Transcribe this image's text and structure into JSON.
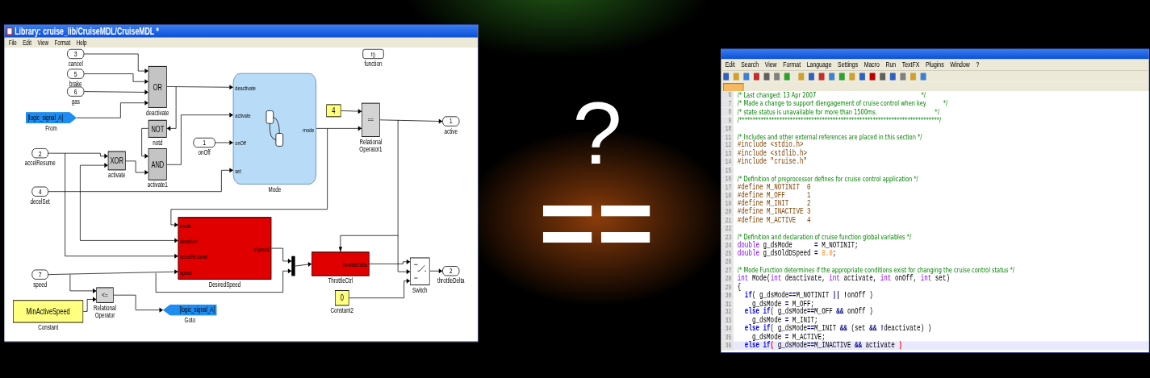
{
  "left_window": {
    "title": "Library: cruise_lib/CruiseMDL/CruiseMDL *",
    "menu": [
      "File",
      "Edit",
      "View",
      "Format",
      "Help"
    ],
    "blocks": [
      {
        "kind": "inport",
        "text": "3",
        "caption": "cancel"
      },
      {
        "kind": "gate",
        "text": "OR",
        "caption": "deactivate"
      },
      {
        "kind": "chart",
        "caption": "Mode",
        "inputs": [
          "deactivate",
          "activate",
          "onOff",
          "set"
        ],
        "outputs": [
          "mode"
        ]
      },
      {
        "kind": "function",
        "text": "f()",
        "caption": "function"
      },
      {
        "kind": "inport",
        "text": "5",
        "caption": "brake"
      },
      {
        "kind": "inport",
        "text": "6",
        "caption": "gas"
      },
      {
        "kind": "from",
        "text": "[logic_signal_A]",
        "caption": "From"
      },
      {
        "kind": "constant",
        "text": "4"
      },
      {
        "kind": "relop",
        "text": "==",
        "caption": "Relational Operator1"
      },
      {
        "kind": "outport",
        "text": "1",
        "caption": "active"
      },
      {
        "kind": "gate",
        "text": "NOT",
        "caption": "notd"
      },
      {
        "kind": "inport",
        "text": "1",
        "caption": "onOff"
      },
      {
        "kind": "inport",
        "text": "2",
        "caption": "accelResume"
      },
      {
        "kind": "gate",
        "text": "XOR",
        "caption": "activate"
      },
      {
        "kind": "gate",
        "text": "AND",
        "caption": "activate1"
      },
      {
        "kind": "inport",
        "text": "4",
        "caption": "decelSet"
      },
      {
        "kind": "inport",
        "text": "7",
        "caption": "speed"
      },
      {
        "kind": "subsystem",
        "caption": "DesiredSpeed",
        "inputs": [
          "mode",
          "decelSet",
          "accelResume",
          "speed"
        ],
        "outputs": [
          "dSpeed"
        ]
      },
      {
        "kind": "mux"
      },
      {
        "kind": "subsystem",
        "caption": "ThrottleCtrl",
        "outputs": [
          "throttleDelta"
        ]
      },
      {
        "kind": "switch",
        "caption": "Switch"
      },
      {
        "kind": "outport",
        "text": "2",
        "caption": "throttleDelta"
      },
      {
        "kind": "relop",
        "text": "<=",
        "caption": "Relational Operator"
      },
      {
        "kind": "constant",
        "text": "MinActiveSpeed",
        "caption": "Constant"
      },
      {
        "kind": "goto",
        "text": "[logic_signal_A]",
        "caption": "Goto"
      },
      {
        "kind": "constant",
        "text": "0",
        "caption": "Constant2"
      }
    ]
  },
  "center": {
    "question_mark": "?",
    "equals_sign": "=="
  },
  "right_window": {
    "menu": [
      "Edit",
      "Search",
      "View",
      "Format",
      "Language",
      "Settings",
      "Macro",
      "Run",
      "TextFX",
      "Plugins",
      "Window",
      "?"
    ],
    "code_lines": [
      {
        "number": "6",
        "current": false,
        "tokens": [
          {
            "kind": "comment",
            "text": "/* Last changed: 13 Apr 2007                                                              */"
          }
        ]
      },
      {
        "number": "7",
        "current": false,
        "tokens": [
          {
            "kind": "comment",
            "text": "/* Made a change to support diengagement of cruise control when key          */"
          }
        ]
      },
      {
        "number": "8",
        "current": false,
        "tokens": [
          {
            "kind": "comment",
            "text": "/* state status is unavailable for more than 1500ms.                                  */"
          }
        ]
      },
      {
        "number": "9",
        "current": false,
        "tokens": [
          {
            "kind": "comment",
            "text": "/***************************************************************************/"
          }
        ]
      },
      {
        "number": "10",
        "current": false
      },
      {
        "number": "11",
        "current": false,
        "tokens": [
          {
            "kind": "comment",
            "text": "/* Includes and other external references are placed in this section */"
          }
        ]
      },
      {
        "number": "12",
        "current": false,
        "tokens": [
          {
            "kind": "directive",
            "text": "#include <stdio.h>"
          }
        ]
      },
      {
        "number": "13",
        "current": false,
        "tokens": [
          {
            "kind": "directive",
            "text": "#include <stdlib.h>"
          }
        ]
      },
      {
        "number": "14",
        "current": false,
        "tokens": [
          {
            "kind": "directive",
            "text": "#include \"cruise.h\""
          }
        ]
      },
      {
        "number": "15",
        "current": false
      },
      {
        "number": "16",
        "current": false,
        "tokens": [
          {
            "kind": "comment",
            "text": "/* Definition of preprocessor defines for cruise control application */"
          }
        ]
      },
      {
        "number": "17",
        "current": false,
        "tokens": [
          {
            "kind": "directive",
            "text": "#define M_NOTINIT  0"
          }
        ]
      },
      {
        "number": "18",
        "current": false,
        "tokens": [
          {
            "kind": "directive",
            "text": "#define M_OFF      1"
          }
        ]
      },
      {
        "number": "19",
        "current": false,
        "tokens": [
          {
            "kind": "directive",
            "text": "#define M_INIT     2"
          }
        ]
      },
      {
        "number": "20",
        "current": false,
        "tokens": [
          {
            "kind": "directive",
            "text": "#define M_INACTIVE 3"
          }
        ]
      },
      {
        "number": "21",
        "current": false,
        "tokens": [
          {
            "kind": "directive",
            "text": "#define M_ACTIVE   4"
          }
        ]
      },
      {
        "number": "22",
        "current": false
      },
      {
        "number": "23",
        "current": false,
        "tokens": [
          {
            "kind": "comment",
            "text": "/* Definition and declaration of cruise function global variables */"
          }
        ]
      },
      {
        "number": "24",
        "current": false,
        "tokens": [
          {
            "kind": "type",
            "text": "double"
          },
          {
            "kind": "plain",
            "text": " g_dsMode      "
          },
          {
            "kind": "operator",
            "text": "="
          },
          {
            "kind": "plain",
            "text": " M_NOTINIT;"
          }
        ]
      },
      {
        "number": "25",
        "current": false,
        "tokens": [
          {
            "kind": "type",
            "text": "double"
          },
          {
            "kind": "plain",
            "text": " g_dsOldDSpeed "
          },
          {
            "kind": "operator",
            "text": "="
          },
          {
            "kind": "number",
            "text": " 0.0"
          },
          {
            "kind": "plain",
            "text": ";"
          }
        ]
      },
      {
        "number": "26",
        "current": false
      },
      {
        "number": "27",
        "current": false,
        "tokens": [
          {
            "kind": "comment",
            "text": "/* Mode Function determines if the appropriate conditions exist for changing the cruise control status */"
          }
        ]
      },
      {
        "number": "28",
        "current": false,
        "tokens": [
          {
            "kind": "type",
            "text": "int"
          },
          {
            "kind": "plain",
            "text": " Mode("
          },
          {
            "kind": "type",
            "text": "int"
          },
          {
            "kind": "plain",
            "text": " deactivate, "
          },
          {
            "kind": "type",
            "text": "int"
          },
          {
            "kind": "plain",
            "text": " activate, "
          },
          {
            "kind": "type",
            "text": "int"
          },
          {
            "kind": "plain",
            "text": " onOff, "
          },
          {
            "kind": "type",
            "text": "int"
          },
          {
            "kind": "plain",
            "text": " set)"
          }
        ]
      },
      {
        "number": "29",
        "current": false,
        "tokens": [
          {
            "kind": "plain",
            "text": "{"
          }
        ]
      },
      {
        "number": "30",
        "current": false,
        "tokens": [
          {
            "kind": "keyword",
            "text": "  if"
          },
          {
            "kind": "plain",
            "text": "( g_dsMode"
          },
          {
            "kind": "operator",
            "text": "=="
          },
          {
            "kind": "plain",
            "text": "M_NOTINIT "
          },
          {
            "kind": "operator",
            "text": "|| !"
          },
          {
            "kind": "plain",
            "text": "onOff )"
          }
        ]
      },
      {
        "number": "31",
        "current": false,
        "tokens": [
          {
            "kind": "plain",
            "text": "    g_dsMode "
          },
          {
            "kind": "operator",
            "text": "="
          },
          {
            "kind": "plain",
            "text": " M_OFF;"
          }
        ]
      },
      {
        "number": "32",
        "current": false,
        "tokens": [
          {
            "kind": "keyword",
            "text": "  else if"
          },
          {
            "kind": "plain",
            "text": "( g_dsMode"
          },
          {
            "kind": "operator",
            "text": "=="
          },
          {
            "kind": "plain",
            "text": "M_OFF "
          },
          {
            "kind": "operator",
            "text": "&&"
          },
          {
            "kind": "plain",
            "text": " onOff )"
          }
        ]
      },
      {
        "number": "33",
        "current": false,
        "tokens": [
          {
            "kind": "plain",
            "text": "    g_dsMode "
          },
          {
            "kind": "operator",
            "text": "="
          },
          {
            "kind": "plain",
            "text": " M_INIT;"
          }
        ]
      },
      {
        "number": "34",
        "current": false,
        "tokens": [
          {
            "kind": "keyword",
            "text": "  else if"
          },
          {
            "kind": "plain",
            "text": "( g_dsMode"
          },
          {
            "kind": "operator",
            "text": "=="
          },
          {
            "kind": "plain",
            "text": "M_INIT "
          },
          {
            "kind": "operator",
            "text": "&&"
          },
          {
            "kind": "plain",
            "text": " (set "
          },
          {
            "kind": "operator",
            "text": "&& !"
          },
          {
            "kind": "plain",
            "text": "deactivate) )"
          }
        ]
      },
      {
        "number": "35",
        "current": false,
        "tokens": [
          {
            "kind": "plain",
            "text": "    g_dsMode "
          },
          {
            "kind": "operator",
            "text": "="
          },
          {
            "kind": "plain",
            "text": " M_ACTIVE;"
          }
        ]
      },
      {
        "number": "36",
        "current": true,
        "tokens": [
          {
            "kind": "keyword",
            "text": "  else if"
          },
          {
            "kind": "bracket",
            "text": "("
          },
          {
            "kind": "plain",
            "text": " g_dsMode"
          },
          {
            "kind": "operator",
            "text": "=="
          },
          {
            "kind": "plain",
            "text": "M_INACTIVE "
          },
          {
            "kind": "operator",
            "text": "&&"
          },
          {
            "kind": "plain",
            "text": " activate "
          },
          {
            "kind": "bracket",
            "text": ")"
          }
        ]
      }
    ]
  }
}
